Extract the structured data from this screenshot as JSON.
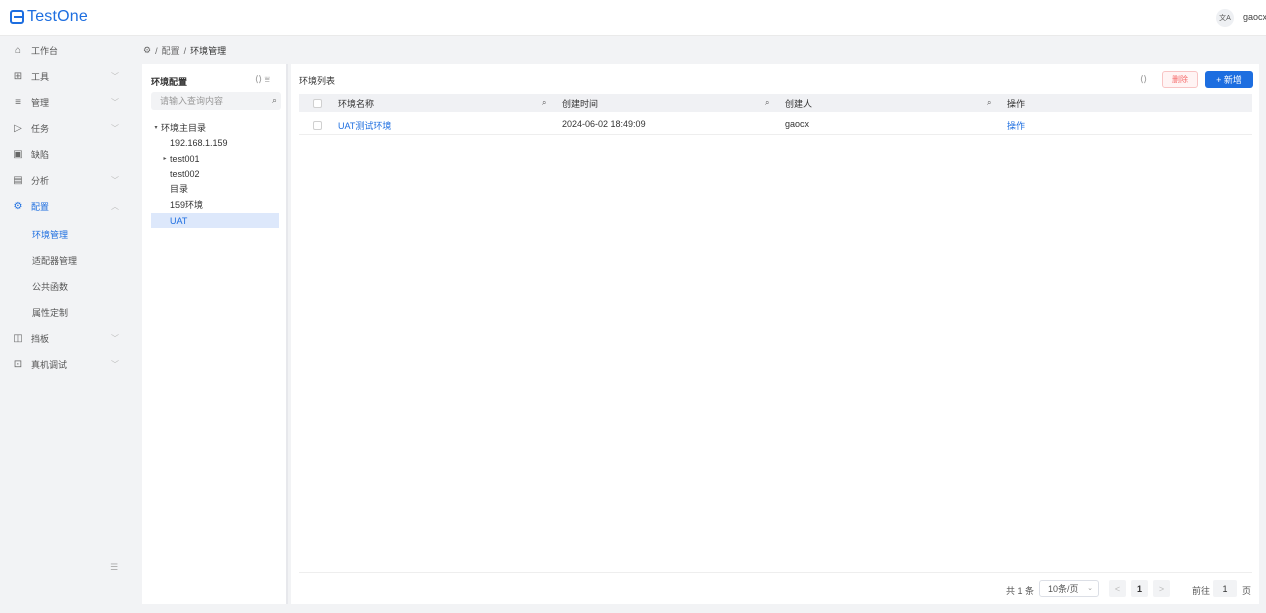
{
  "header": {
    "app_name": "TestOne",
    "lang_icon": "translate-icon",
    "lang_label": "文A",
    "user": "gaocx"
  },
  "sidebar": {
    "items": [
      {
        "label": "工作台",
        "icon": "home-icon",
        "glyph": "⌂",
        "chevron": ""
      },
      {
        "label": "工具",
        "icon": "grid-icon",
        "glyph": "⊞",
        "chevron": "﹀"
      },
      {
        "label": "管理",
        "icon": "list-icon",
        "glyph": "≡",
        "chevron": "﹀"
      },
      {
        "label": "任务",
        "icon": "play-icon",
        "glyph": "▷",
        "chevron": "﹀"
      },
      {
        "label": "缺陷",
        "icon": "defect-icon",
        "glyph": "▣",
        "chevron": ""
      },
      {
        "label": "分析",
        "icon": "calendar-icon",
        "glyph": "▤",
        "chevron": "﹀"
      },
      {
        "label": "配置",
        "icon": "settings-icon",
        "glyph": "⚙",
        "chevron": "︿"
      },
      {
        "label": "挡板",
        "icon": "panel-icon",
        "glyph": "◫",
        "chevron": "﹀"
      },
      {
        "label": "真机调试",
        "icon": "device-icon",
        "glyph": "⊡",
        "chevron": "﹀"
      }
    ],
    "sub_items": [
      {
        "label": "环境管理"
      },
      {
        "label": "适配器管理"
      },
      {
        "label": "公共函数"
      },
      {
        "label": "属性定制"
      }
    ],
    "collapse_glyph": "☰"
  },
  "breadcrumb": {
    "icon": "gear-icon",
    "glyph": "⚙",
    "sep": "/",
    "parent": "配置",
    "current": "环境管理"
  },
  "tree": {
    "title": "环境配置",
    "tools_glyph": "⟨⟩ ⩸",
    "search_placeholder": "请输入查询内容",
    "search_glyph": "⌕",
    "nodes": [
      {
        "label": "环境主目录",
        "arrow": "▾",
        "indent": 0
      },
      {
        "label": "192.168.1.159",
        "arrow": "",
        "indent": 1
      },
      {
        "label": "test001",
        "arrow": "▸",
        "indent": 1
      },
      {
        "label": "test002",
        "arrow": "",
        "indent": 1
      },
      {
        "label": "目录",
        "arrow": "",
        "indent": 1
      },
      {
        "label": "159环境",
        "arrow": "",
        "indent": 1
      },
      {
        "label": "UAT",
        "arrow": "",
        "indent": 1
      }
    ]
  },
  "main": {
    "title": "环境列表",
    "refresh_glyph": "⟨⟩",
    "delete_label": "删除",
    "add_label": "+ 新增",
    "columns": [
      {
        "label": "环境名称"
      },
      {
        "label": "创建时间"
      },
      {
        "label": "创建人"
      },
      {
        "label": "操作"
      }
    ],
    "search_glyph": "⌕",
    "rows": [
      {
        "name": "UAT测试环境",
        "created": "2024-06-02 18:49:09",
        "creator": "gaocx",
        "action": "操作"
      }
    ]
  },
  "pagination": {
    "total": "共 1 条",
    "page_size": "10条/页",
    "size_arrow": "⌄",
    "prev": "<",
    "current": "1",
    "next": ">",
    "goto_label": "前往",
    "goto_value": "1",
    "unit": "页"
  }
}
